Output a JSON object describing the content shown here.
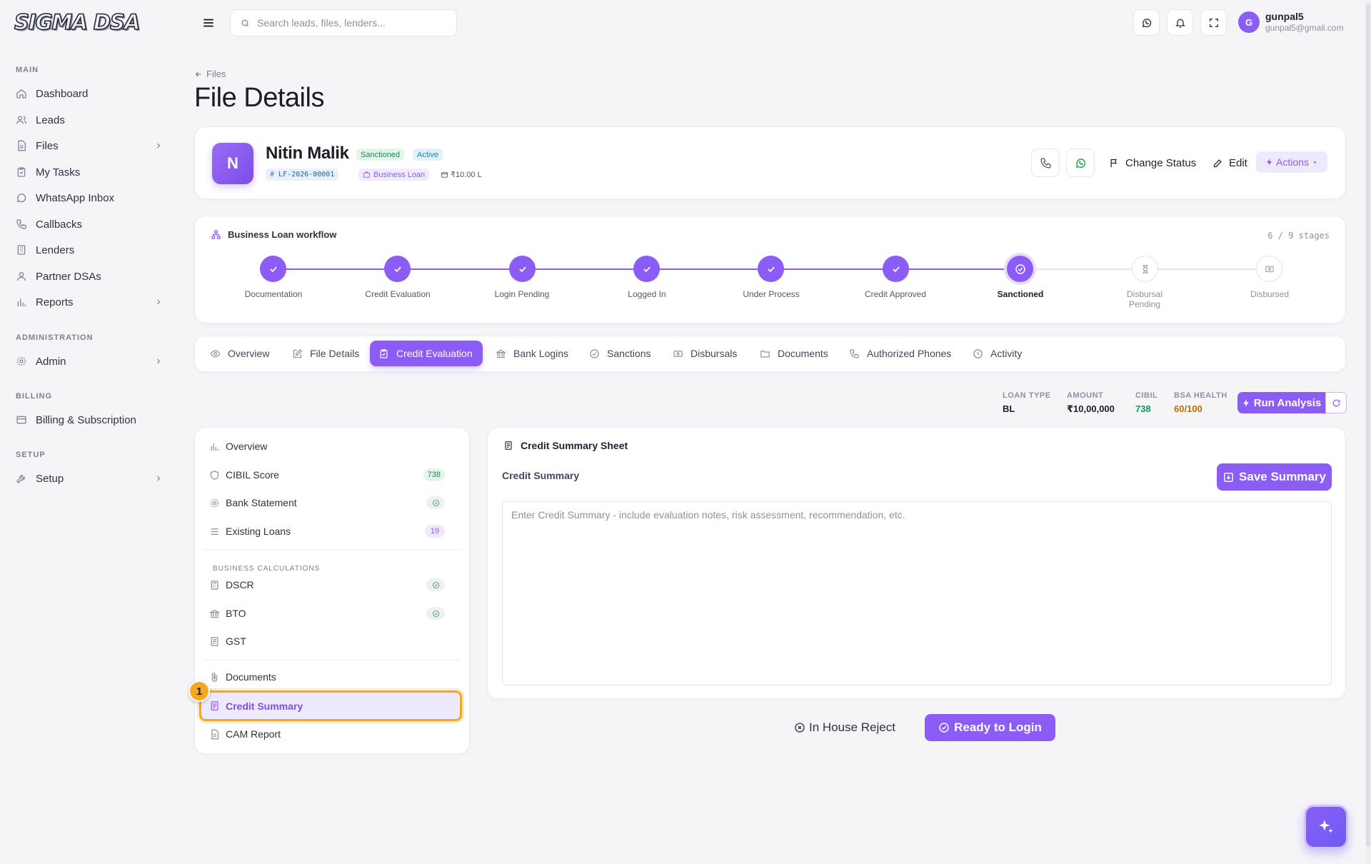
{
  "brand": {
    "logo_text": "SIGMA DSA",
    "accent": "#8b5cf6"
  },
  "sidebar": {
    "sections": {
      "main": "MAIN",
      "administration": "ADMINISTRATION",
      "billing": "BILLING",
      "setup": "SETUP"
    },
    "items": [
      {
        "label": "Dashboard",
        "icon": "home-icon"
      },
      {
        "label": "Leads",
        "icon": "users-icon"
      },
      {
        "label": "Files",
        "icon": "file-icon",
        "expandable": true
      },
      {
        "label": "My Tasks",
        "icon": "clipboard-icon"
      },
      {
        "label": "WhatsApp Inbox",
        "icon": "chat-icon"
      },
      {
        "label": "Callbacks",
        "icon": "phone-icon"
      },
      {
        "label": "Lenders",
        "icon": "building-icon"
      },
      {
        "label": "Partner DSAs",
        "icon": "users-icon"
      },
      {
        "label": "Reports",
        "icon": "bar-chart-icon",
        "expandable": true
      },
      {
        "label": "Admin",
        "icon": "gear-icon",
        "expandable": true
      },
      {
        "label": "Billing & Subscription",
        "icon": "credit-card-icon"
      },
      {
        "label": "Setup",
        "icon": "wrench-icon",
        "expandable": true
      }
    ]
  },
  "topbar": {
    "search_placeholder": "Search leads, files, lenders...",
    "user": {
      "initial": "G",
      "name": "gunpal5",
      "email": "gunpal5@gmail.com"
    }
  },
  "page": {
    "breadcrumb": "Files",
    "title": "File Details"
  },
  "file": {
    "initial": "N",
    "name": "Nitin Malik",
    "status_badge": "Sanctioned",
    "active_badge": "Active",
    "file_id": "LF-2026-00001",
    "loan_type": "Business Loan",
    "amount_short": "₹10.00 L",
    "change_status_label": "Change Status",
    "edit_label": "Edit",
    "actions_label": "Actions"
  },
  "workflow": {
    "title": "Business Loan workflow",
    "count": "6 / 9 stages",
    "stages": [
      {
        "label": "Documentation",
        "state": "done"
      },
      {
        "label": "Credit Evaluation",
        "state": "done"
      },
      {
        "label": "Login Pending",
        "state": "done"
      },
      {
        "label": "Logged In",
        "state": "done"
      },
      {
        "label": "Under Process",
        "state": "done"
      },
      {
        "label": "Credit Approved",
        "state": "done"
      },
      {
        "label": "Sanctioned",
        "state": "current"
      },
      {
        "label": "Disbursal Pending",
        "state": "pending"
      },
      {
        "label": "Disbursed",
        "state": "pending"
      }
    ]
  },
  "tabs": [
    {
      "label": "Overview",
      "icon": "eye-icon"
    },
    {
      "label": "File Details",
      "icon": "edit-icon"
    },
    {
      "label": "Credit Evaluation",
      "icon": "clipboard-check-icon",
      "active": true
    },
    {
      "label": "Bank Logins",
      "icon": "bank-icon"
    },
    {
      "label": "Sanctions",
      "icon": "check-circle-icon"
    },
    {
      "label": "Disbursals",
      "icon": "cash-icon"
    },
    {
      "label": "Documents",
      "icon": "folder-icon"
    },
    {
      "label": "Authorized Phones",
      "icon": "phone-icon"
    },
    {
      "label": "Activity",
      "icon": "clock-icon"
    }
  ],
  "stats": {
    "loan_type": {
      "label": "LOAN TYPE",
      "value": "BL"
    },
    "amount": {
      "label": "AMOUNT",
      "value": "₹10,00,000"
    },
    "cibil": {
      "label": "CIBIL",
      "value": "738",
      "color": "#15925f"
    },
    "bsa": {
      "label": "BSA HEALTH",
      "value": "60/100",
      "color": "#b86e0b"
    },
    "run_label": "Run Analysis"
  },
  "eval_nav": {
    "section_label": "BUSINESS CALCULATIONS",
    "items": [
      {
        "label": "Overview"
      },
      {
        "label": "CIBIL Score",
        "badge": "738"
      },
      {
        "label": "Bank Statement",
        "check": true
      },
      {
        "label": "Existing Loans",
        "badge": "19"
      },
      {
        "label": "DSCR",
        "check": true
      },
      {
        "label": "BTO",
        "check": true
      },
      {
        "label": "GST"
      },
      {
        "label": "Documents"
      },
      {
        "label": "Credit Summary",
        "selected": true
      },
      {
        "label": "CAM Report"
      }
    ],
    "marker": "1"
  },
  "summary": {
    "title": "Credit Summary Sheet",
    "field_label": "Credit Summary",
    "save_label": "Save Summary",
    "placeholder": "Enter Credit Summary - include evaluation notes, risk assessment, recommendation, etc.",
    "value": ""
  },
  "footer_actions": {
    "reject_label": "In House Reject",
    "ready_label": "Ready to Login"
  }
}
